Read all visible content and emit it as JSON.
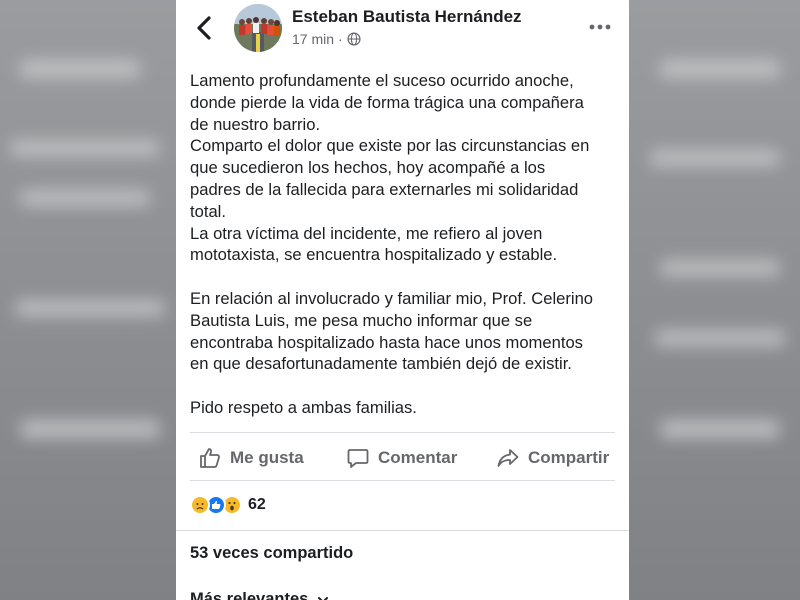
{
  "post": {
    "author": "Esteban Bautista Hernández",
    "time": "17 min",
    "separator": "·",
    "audience_icon": "globe-icon",
    "paragraphs": [
      [
        "Lamento profundamente el suceso ocurrido anoche,",
        "donde pierde la vida de forma trágica una compañera",
        "de nuestro barrio.",
        "Comparto el dolor que existe por las circunstancias en",
        "que sucedieron los hechos, hoy acompañé a los",
        "padres de la fallecida para externarles mi solidaridad",
        "total.",
        "La otra víctima del incidente, me refiero al joven",
        "mototaxista, se encuentra hospitalizado y estable."
      ],
      [
        "En relación al involucrado y familiar mio, Prof. Celerino",
        "Bautista Luis, me pesa mucho informar que se",
        "encontraba hospitalizado hasta hace unos momentos",
        "en que desafortunadamente también dejó de existir."
      ],
      [
        "Pido respeto a ambas familias."
      ]
    ]
  },
  "actions": {
    "like": "Me gusta",
    "comment": "Comentar",
    "share": "Compartir"
  },
  "reactions": {
    "icons": [
      "sad-reaction-icon",
      "like-reaction-icon",
      "wow-reaction-icon"
    ],
    "count": "62"
  },
  "shares": "53 veces compartido",
  "sort": {
    "label": "Más relevantes"
  },
  "colors": {
    "text": "#1c1e21",
    "muted": "#65676b",
    "like_blue": "#1877f2",
    "reaction_yellow": "#f7b928"
  }
}
